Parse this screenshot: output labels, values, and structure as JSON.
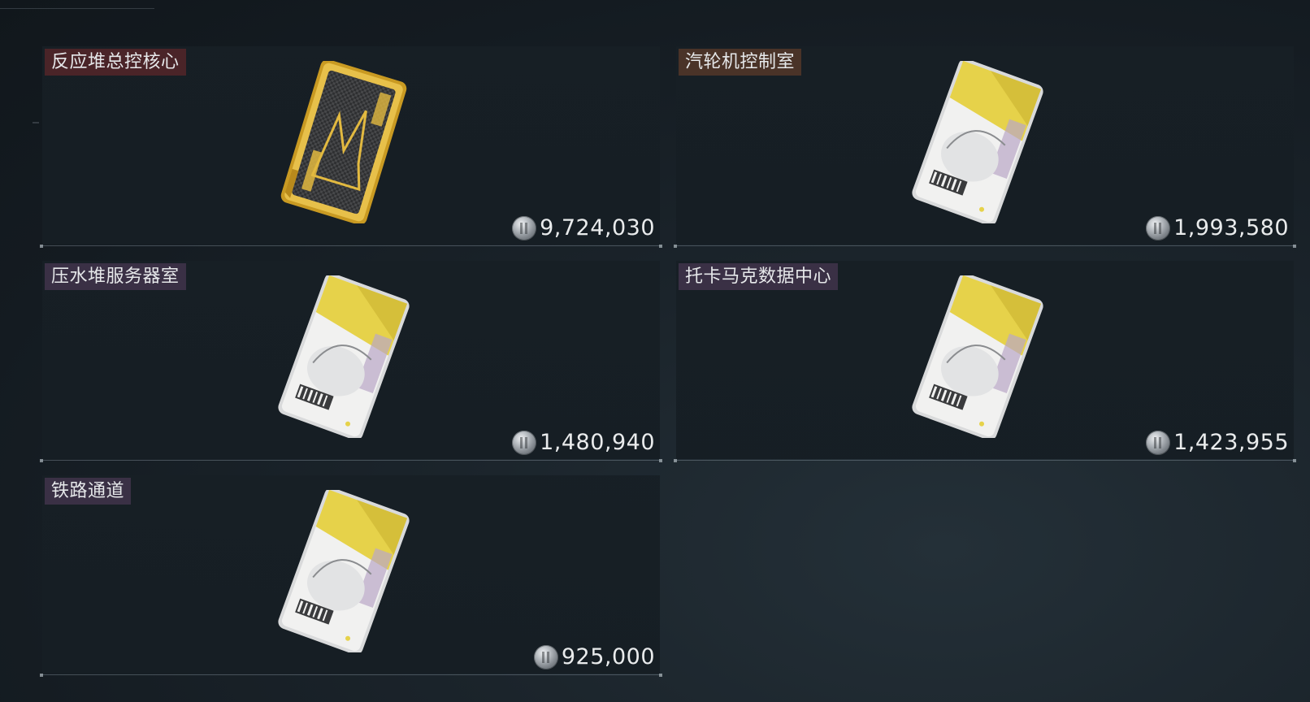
{
  "items": [
    {
      "name": "反应堆总控核心",
      "price": "9,724,030",
      "card_type": "gold",
      "tag_color": "#4a2428"
    },
    {
      "name": "汽轮机控制室",
      "price": "1,993,580",
      "card_type": "white",
      "tag_color": "#4a3328"
    },
    {
      "name": "压水堆服务器室",
      "price": "1,480,940",
      "card_type": "white",
      "tag_color": "#3a3045"
    },
    {
      "name": "托卡马克数据中心",
      "price": "1,423,955",
      "card_type": "white",
      "tag_color": "#3a3045"
    },
    {
      "name": "铁路通道",
      "price": "925,000",
      "card_type": "white",
      "tag_color": "#3a3045"
    }
  ],
  "currency_icon": "silver-coin-icon"
}
